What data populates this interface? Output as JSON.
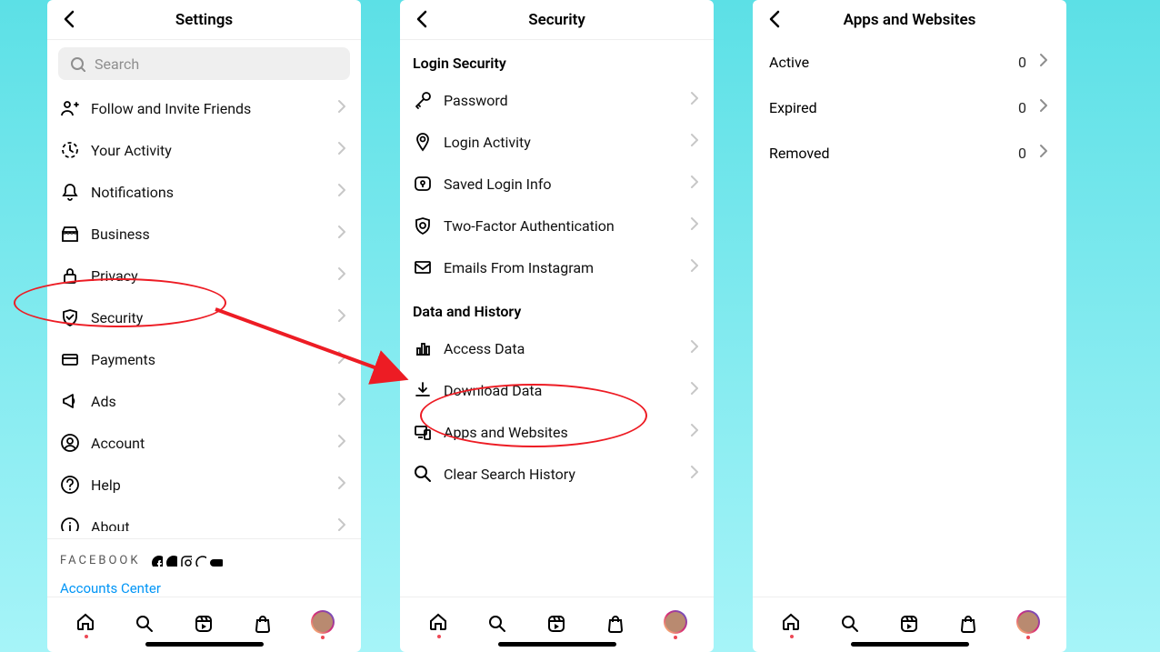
{
  "panel1": {
    "title": "Settings",
    "search_placeholder": "Search",
    "items": [
      {
        "icon": "person-plus-icon",
        "label": "Follow and Invite Friends"
      },
      {
        "icon": "clock-icon",
        "label": "Your Activity"
      },
      {
        "icon": "bell-icon",
        "label": "Notifications"
      },
      {
        "icon": "storefront-icon",
        "label": "Business"
      },
      {
        "icon": "lock-icon",
        "label": "Privacy"
      },
      {
        "icon": "shield-icon",
        "label": "Security"
      },
      {
        "icon": "card-icon",
        "label": "Payments"
      },
      {
        "icon": "megaphone-icon",
        "label": "Ads"
      },
      {
        "icon": "account-icon",
        "label": "Account"
      },
      {
        "icon": "help-icon",
        "label": "Help"
      },
      {
        "icon": "info-icon",
        "label": "About"
      }
    ],
    "brand": "FACEBOOK",
    "accounts_center": "Accounts Center"
  },
  "panel2": {
    "title": "Security",
    "sections": [
      {
        "title": "Login Security",
        "items": [
          {
            "icon": "key-icon",
            "label": "Password"
          },
          {
            "icon": "pin-icon",
            "label": "Login Activity"
          },
          {
            "icon": "keyhole-icon",
            "label": "Saved Login Info"
          },
          {
            "icon": "shield-check-icon",
            "label": "Two-Factor Authentication"
          },
          {
            "icon": "mail-icon",
            "label": "Emails From Instagram"
          }
        ]
      },
      {
        "title": "Data and History",
        "items": [
          {
            "icon": "barchart-icon",
            "label": "Access Data"
          },
          {
            "icon": "download-icon",
            "label": "Download Data"
          },
          {
            "icon": "devices-icon",
            "label": "Apps and Websites"
          },
          {
            "icon": "search-icon",
            "label": "Clear Search History"
          }
        ]
      }
    ]
  },
  "panel3": {
    "title": "Apps and Websites",
    "rows": [
      {
        "label": "Active",
        "count": "0"
      },
      {
        "label": "Expired",
        "count": "0"
      },
      {
        "label": "Removed",
        "count": "0"
      }
    ]
  }
}
